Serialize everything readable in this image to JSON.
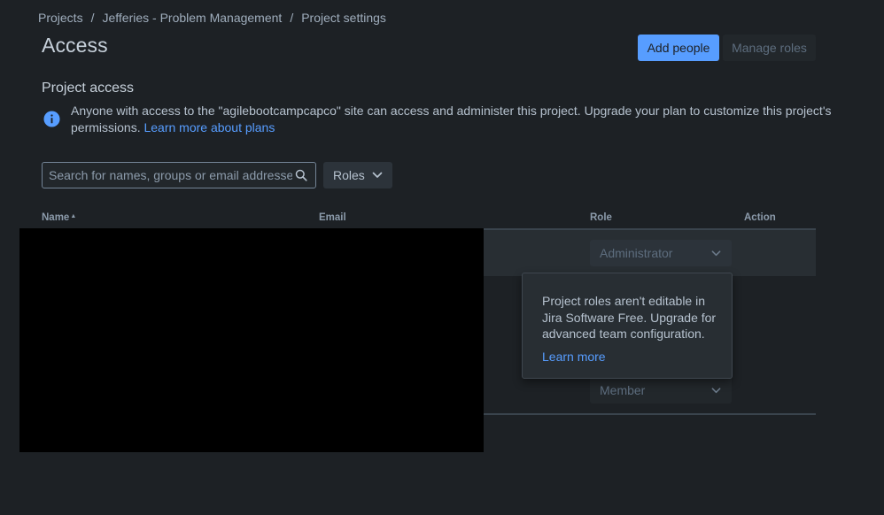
{
  "breadcrumb": {
    "items": [
      "Projects",
      "Jefferies - Problem Management",
      "Project settings"
    ],
    "separator": "/"
  },
  "header": {
    "title": "Access",
    "add_people_label": "Add people",
    "manage_roles_label": "Manage roles"
  },
  "project_access": {
    "title": "Project access",
    "info_icon": "info-icon",
    "message": "Anyone with access to the \"agilebootcampcapco\" site can access and administer this project. Upgrade your plan to customize this project's permissions. ",
    "link_label": "Learn more about plans"
  },
  "filters": {
    "search_placeholder": "Search for names, groups or email addresses",
    "search_icon": "search-icon",
    "roles_label": "Roles"
  },
  "table": {
    "columns": {
      "name": "Name",
      "email": "Email",
      "role": "Role",
      "action": "Action"
    },
    "rows": [
      {
        "role": "Administrator"
      },
      {
        "role": "Member"
      }
    ]
  },
  "tooltip": {
    "text": "Project roles aren't editable in Jira Software Free. Upgrade for advanced team configuration.",
    "link_label": "Learn more"
  },
  "colors": {
    "background": "#1d2125",
    "accent": "#579dff",
    "redaction": "#000000"
  }
}
